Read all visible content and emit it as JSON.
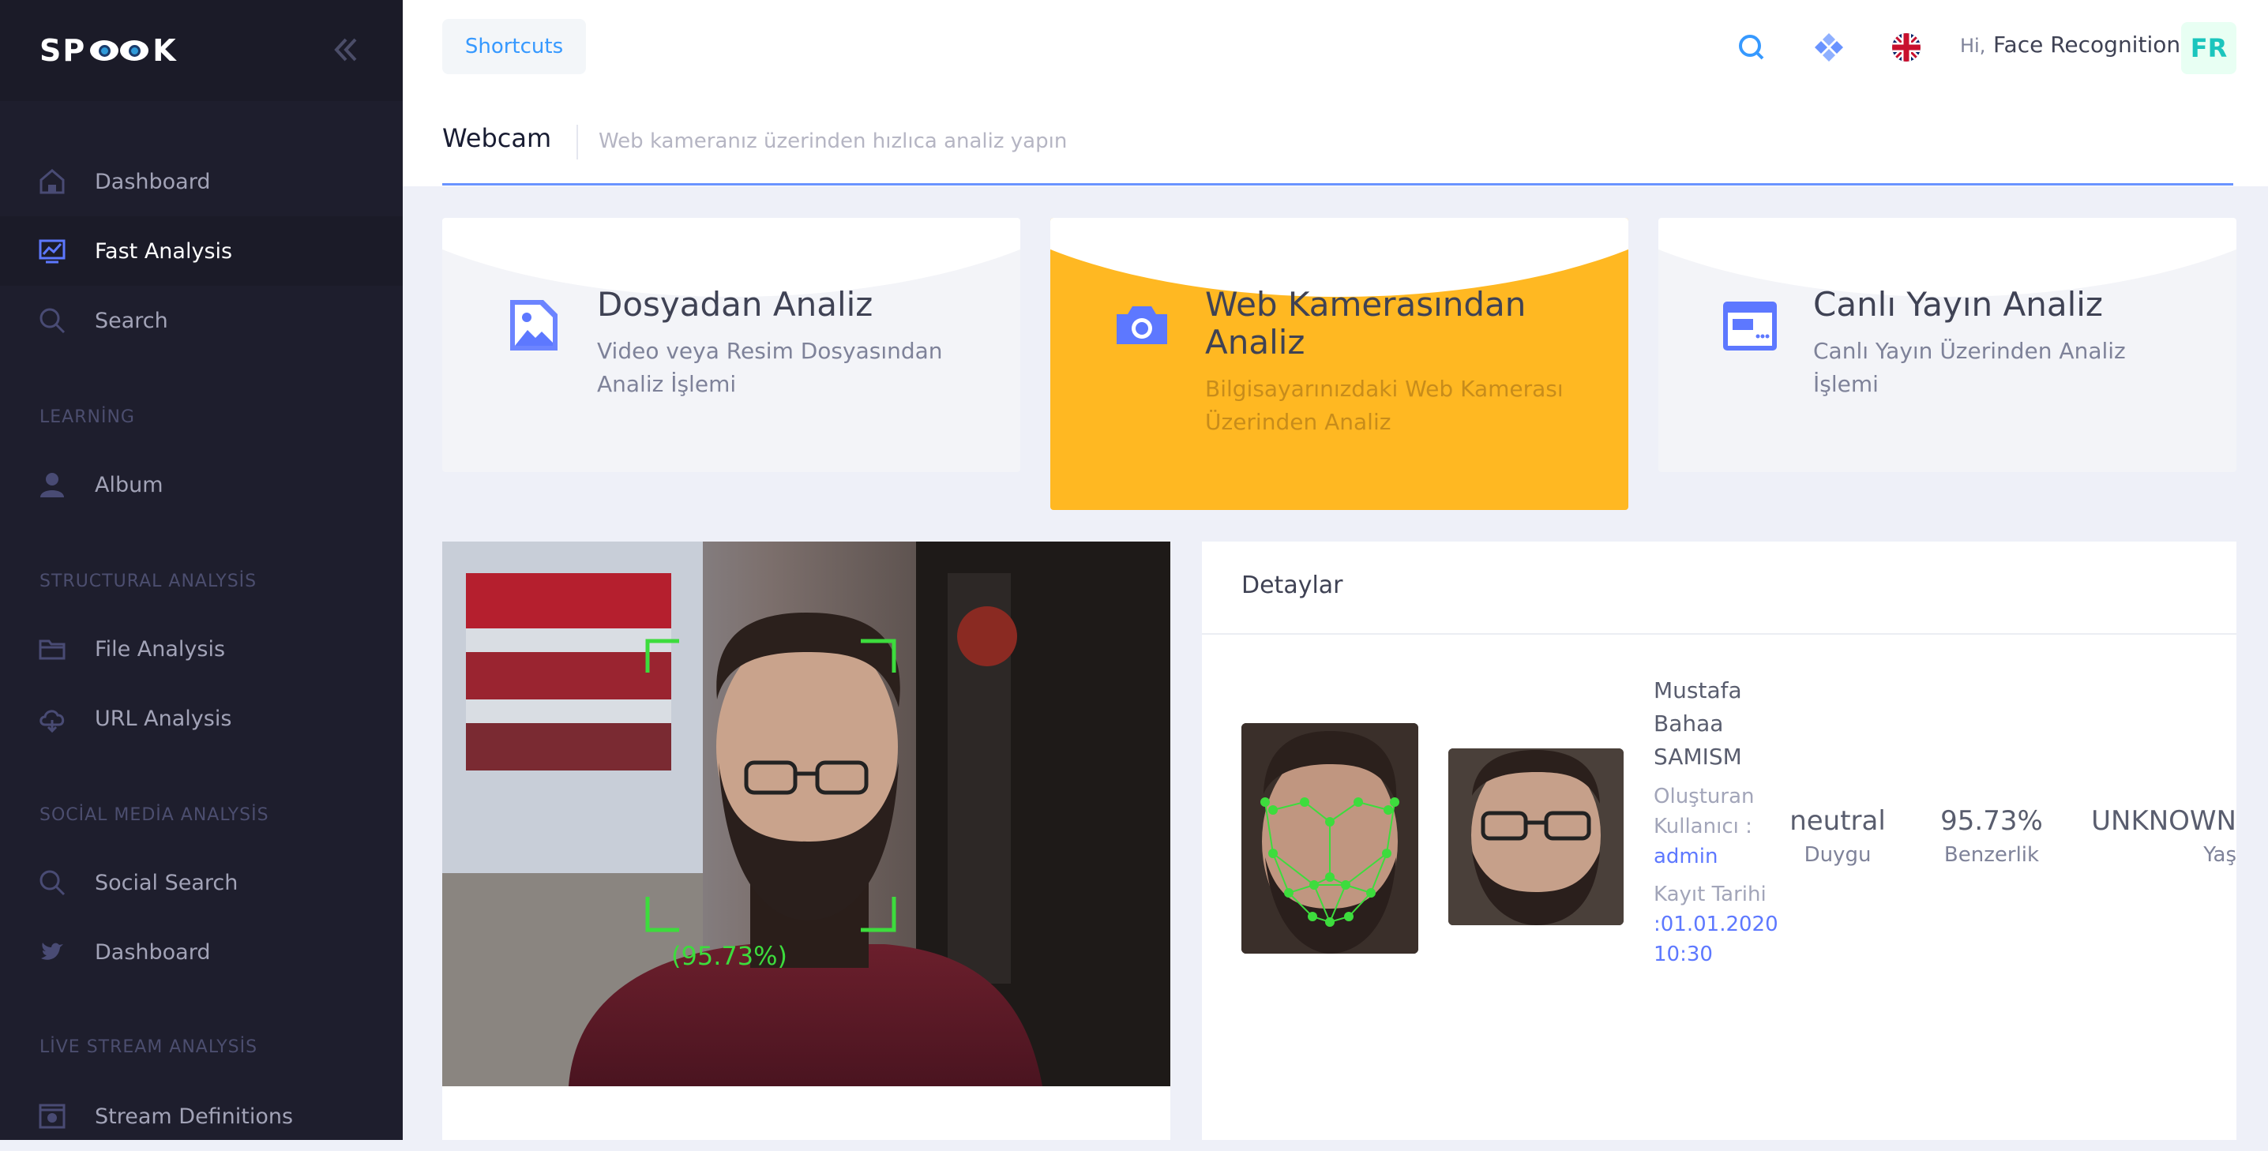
{
  "brand": {
    "logo_left": "SP",
    "logo_right": "K"
  },
  "sidebar": {
    "items": [
      {
        "label": "Dashboard",
        "icon": "home-icon"
      },
      {
        "label": "Fast Analysis",
        "icon": "chart-icon",
        "active": true
      },
      {
        "label": "Search",
        "icon": "search-icon"
      },
      {
        "label": "Album",
        "icon": "user-icon"
      },
      {
        "label": "File Analysis",
        "icon": "folder-icon"
      },
      {
        "label": "URL Analysis",
        "icon": "cloud-icon"
      },
      {
        "label": "Social Search",
        "icon": "search-icon"
      },
      {
        "label": "Dashboard",
        "icon": "twitter-icon"
      },
      {
        "label": "Stream Definitions",
        "icon": "stream-icon"
      }
    ],
    "sections": {
      "learning": "LEARNİNG",
      "structural": "STRUCTURAL ANALYSİS",
      "social": "SOCİAL MEDİA ANALYSİS",
      "live": "LİVE STREAM ANALYSİS"
    }
  },
  "header": {
    "shortcuts": "Shortcuts",
    "greeting": "Hi,",
    "user_name": "Face Recognition",
    "avatar_initials": "FR"
  },
  "subheader": {
    "title": "Webcam",
    "description": "Web kameranız üzerinden hızlıca analiz yapın"
  },
  "cards": [
    {
      "title": "Dosyadan Analiz",
      "desc": "Video veya Resim Dosyasından Analiz İşlemi",
      "icon": "image-icon"
    },
    {
      "title": "Web Kamerasından Analiz",
      "desc": "Bilgisayarınızdaki Web Kamerası Üzerinden Analiz",
      "icon": "camera-icon",
      "active": true
    },
    {
      "title": "Canlı Yayın Analiz",
      "desc": "Canlı Yayın Üzerinden Analiz İşlemi",
      "icon": "stream-window-icon"
    }
  ],
  "webcam": {
    "confidence": "(95.73%)"
  },
  "details": {
    "title": "Detaylar",
    "person_name": "Mustafa Bahaa SAMISM",
    "created_by_label": "Oluşturan Kullanıcı :",
    "created_by": "admin",
    "date_label": "Kayıt Tarihi",
    "date": ":01.01.2020 10:30",
    "emotion": "neutral",
    "emotion_label": "Duygu",
    "similarity": "95.73%",
    "similarity_label": "Benzerlik",
    "age": "UNKNOWN",
    "age_label": "Yaş"
  },
  "colors": {
    "sidebar": "#1e1e2d",
    "accent": "#ffb822",
    "primary": "#5d78ff",
    "face_box": "#3ddc3d"
  }
}
